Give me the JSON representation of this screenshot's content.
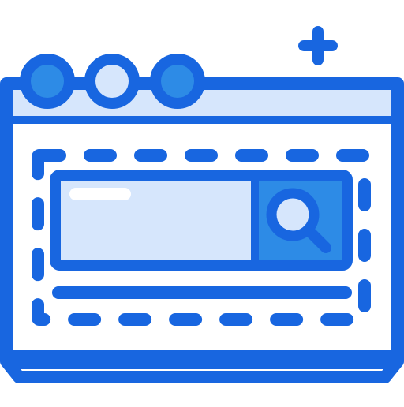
{
  "icon": {
    "name": "browser-search-window-icon",
    "colors": {
      "stroke": "#1866e0",
      "light_fill": "#d6e6fc",
      "mid_fill": "#2d8be6",
      "white": "#ffffff"
    }
  },
  "window": {
    "title_bar": {
      "controls": [
        "close-dot",
        "minimize-dot",
        "maximize-dot"
      ]
    },
    "add_tab_glyph": "plus-icon"
  },
  "search": {
    "input_value": "",
    "button_icon": "search-icon"
  }
}
